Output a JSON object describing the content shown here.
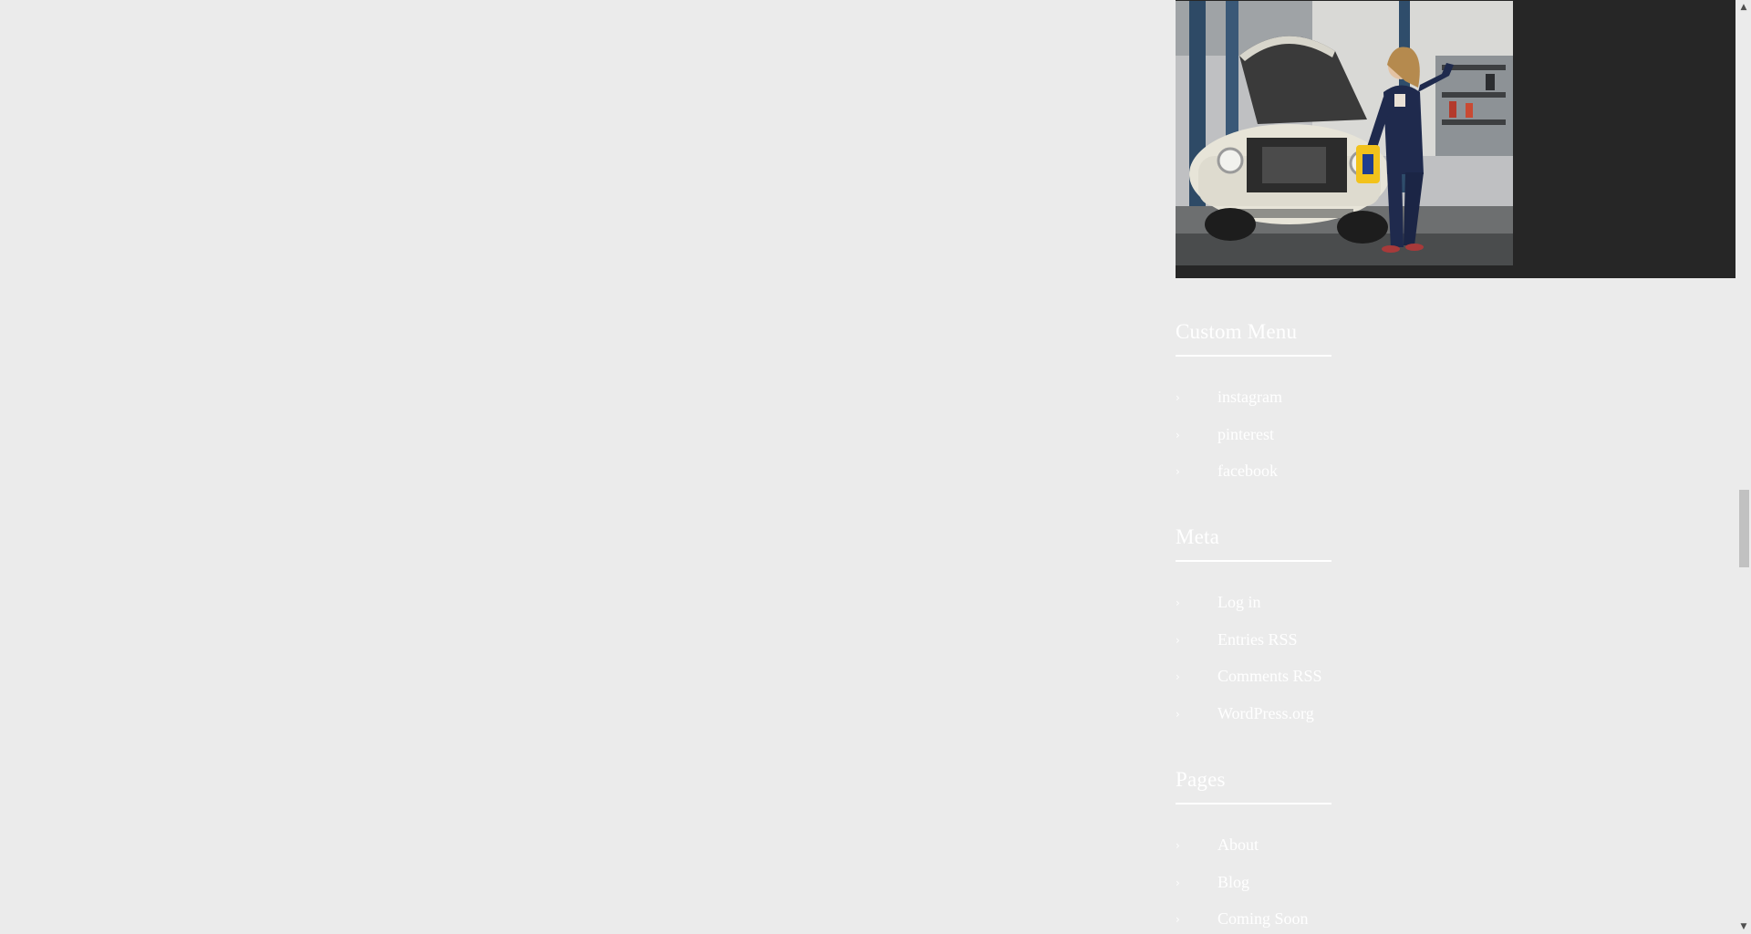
{
  "photo": {
    "alt": "Mechanic woman leaning on vintage car in garage"
  },
  "widgets": {
    "custom_menu": {
      "title": "Custom Menu",
      "items": [
        {
          "label": "instagram"
        },
        {
          "label": "pinterest"
        },
        {
          "label": "facebook"
        }
      ]
    },
    "meta": {
      "title": "Meta",
      "items": [
        {
          "label": "Log in"
        },
        {
          "label": "Entries RSS"
        },
        {
          "label": "Comments RSS"
        },
        {
          "label": "WordPress.org"
        }
      ]
    },
    "pages": {
      "title": "Pages",
      "items": [
        {
          "label": "About"
        },
        {
          "label": "Blog"
        },
        {
          "label": "Coming Soon"
        }
      ]
    }
  },
  "icons": {
    "list_bullet": "chevron-right-icon",
    "scroll_up": "triangle-up-icon",
    "scroll_down": "triangle-down-icon"
  },
  "colors": {
    "page_background": "#ebebeb",
    "widget_box": "#262626",
    "text": "#ffffff",
    "scroll_thumb": "#c1c1c1"
  },
  "scroll": {
    "position_fraction": 0.6
  }
}
